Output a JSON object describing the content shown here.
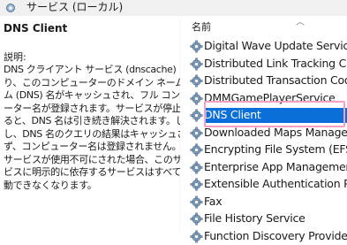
{
  "header": {
    "title": "サービス (ローカル)"
  },
  "details": {
    "service_name": "DNS Client",
    "description_label": "説明:",
    "description_lines": [
      "DNS クライアント サービス (dnscache) によ",
      "り、このコンピューターのドメイン ネーム システ",
      "ム (DNS) 名がキャッシュされ、フル コンピュ",
      "ーター名が登録されます。サービスが停止され",
      "ると、DNS 名は引き続き解決されます。しか",
      "し、DNS 名のクエリの結果はキャッシュされ",
      "ず、コンピューター名は登録されません。",
      "サービスが使用不可にされた場合、このサー",
      "ビスに明示的に依存するサービスはすべて起",
      "動できなくなります。"
    ]
  },
  "list": {
    "column_header": "名前",
    "selected_index": 4,
    "items": [
      "Digital Wave Update Service",
      "Distributed Link Tracking Client",
      "Distributed Transaction Coordinator",
      "DMMGamePlayerService",
      "DNS Client",
      "Downloaded Maps Manager",
      "Encrypting File System (EFS)",
      "Enterprise App Management Service",
      "Extensible Authentication Protocol",
      "Fax",
      "File History Service",
      "Function Discovery Provider Host"
    ],
    "icon_names": "gear-icon"
  },
  "colors": {
    "selection": "#0a6fd8",
    "focus_outline": "#f6a1c4"
  }
}
